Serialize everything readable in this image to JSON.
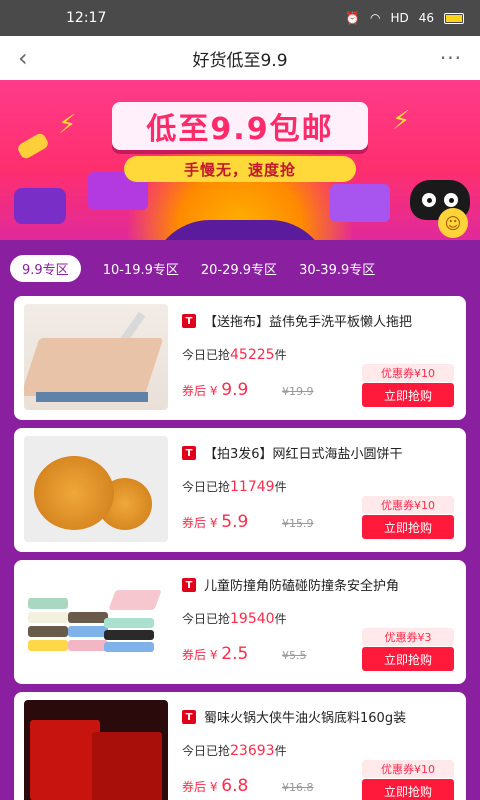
{
  "status_bar": {
    "time": "12:17",
    "network": "HD",
    "signal": "46"
  },
  "nav": {
    "back_icon": "‹",
    "title": "好货低至9.9",
    "more_icon": "···"
  },
  "banner": {
    "headline": "低至9.9包邮",
    "subline": "手慢无，速度抢"
  },
  "tabs": [
    {
      "label": "9.9专区",
      "active": true
    },
    {
      "label": "10-19.9专区",
      "active": false
    },
    {
      "label": "20-29.9专区",
      "active": false
    },
    {
      "label": "30-39.9专区",
      "active": false
    }
  ],
  "products": [
    {
      "title": "【送拖布】益伟免手洗平板懒人拖把",
      "sold_prefix": "今日已抢",
      "sold_count": "45225",
      "sold_unit": "件",
      "price_prefix": "券后 ¥",
      "price": "9.9",
      "original": "¥19.9",
      "coupon": "优惠券¥10",
      "button": "立即抢购"
    },
    {
      "title": "【拍3发6】网红日式海盐小圆饼干",
      "sold_prefix": "今日已抢",
      "sold_count": "11749",
      "sold_unit": "件",
      "price_prefix": "券后 ¥",
      "price": "5.9",
      "original": "¥15.9",
      "coupon": "优惠券¥10",
      "button": "立即抢购"
    },
    {
      "title": "儿童防撞角防磕碰防撞条安全护角",
      "sold_prefix": "今日已抢",
      "sold_count": "19540",
      "sold_unit": "件",
      "price_prefix": "券后 ¥",
      "price": "2.5",
      "original": "¥5.5",
      "coupon": "优惠券¥3",
      "button": "立即抢购"
    },
    {
      "title": "蜀味火锅大侠牛油火锅底料160g装",
      "sold_prefix": "今日已抢",
      "sold_count": "23693",
      "sold_unit": "件",
      "price_prefix": "券后 ¥",
      "price": "6.8",
      "original": "¥16.8",
      "coupon": "优惠券¥10",
      "button": "立即抢购"
    }
  ],
  "colors": {
    "page_bg": "#8a1fa0",
    "price_red": "#ff2a4d",
    "button_red": "#ff1a3c",
    "status_bar": "#4a4a4a"
  }
}
